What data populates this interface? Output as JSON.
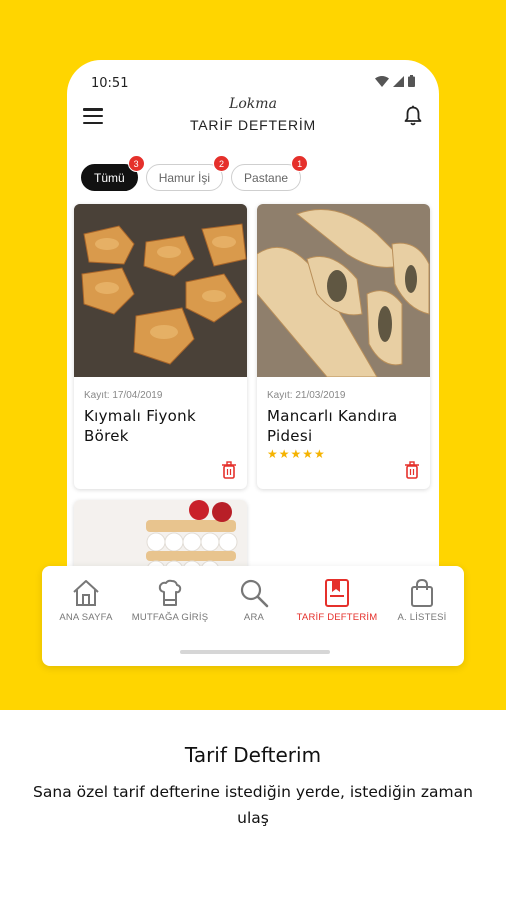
{
  "status_bar": {
    "time": "10:51"
  },
  "header": {
    "logo": "Lokma",
    "title": "TARİF DEFTERİM"
  },
  "filters": [
    {
      "label": "Tümü",
      "count": "3",
      "active": true
    },
    {
      "label": "Hamur İşi",
      "count": "2",
      "active": false
    },
    {
      "label": "Pastane",
      "count": "1",
      "active": false
    }
  ],
  "recipes": [
    {
      "date": "Kayıt: 17/04/2019",
      "title": "Kıymalı Fiyonk Börek",
      "rating": ""
    },
    {
      "date": "Kayıt: 21/03/2019",
      "title": "Mancarlı Kandıra Pidesi",
      "rating": "★★★★★"
    },
    {
      "date": "",
      "title": "",
      "rating": ""
    }
  ],
  "bottom_nav": [
    {
      "label": "ANA SAYFA",
      "icon": "home-icon",
      "active": false
    },
    {
      "label": "MUTFAĞA GİRİŞ",
      "icon": "chef-hat-icon",
      "active": false
    },
    {
      "label": "ARA",
      "icon": "search-icon",
      "active": false
    },
    {
      "label": "TARİF DEFTERİM",
      "icon": "notebook-icon",
      "active": true
    },
    {
      "label": "A. LİSTESİ",
      "icon": "shopping-bag-icon",
      "active": false
    }
  ],
  "caption": {
    "title": "Tarif Defterim",
    "text": "Sana özel tarif defterine istediğin yerde, istediğin zaman ulaş"
  },
  "colors": {
    "background": "#FFD500",
    "accent": "#E5302B",
    "star": "#F5B301"
  }
}
